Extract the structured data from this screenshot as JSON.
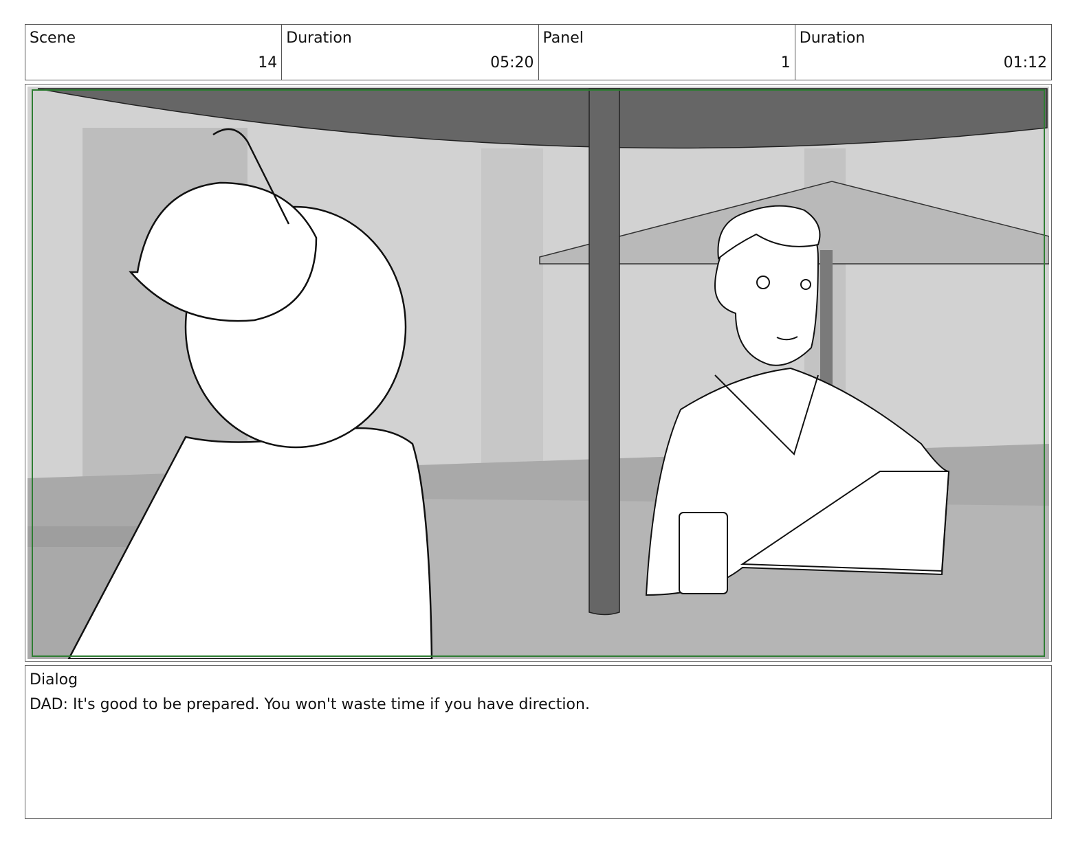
{
  "header": {
    "scene_label": "Scene",
    "scene_value": "14",
    "scene_duration_label": "Duration",
    "scene_duration_value": "05:20",
    "panel_label": "Panel",
    "panel_value": "1",
    "panel_duration_label": "Duration",
    "panel_duration_value": "01:12"
  },
  "dialog": {
    "label": "Dialog",
    "text": "DAD: It's good to be prepared. You won't waste time if you have direction."
  },
  "colors": {
    "frame_guide": "#2e7d32",
    "umbrella": "#666666",
    "background": "#cfcfcf"
  }
}
